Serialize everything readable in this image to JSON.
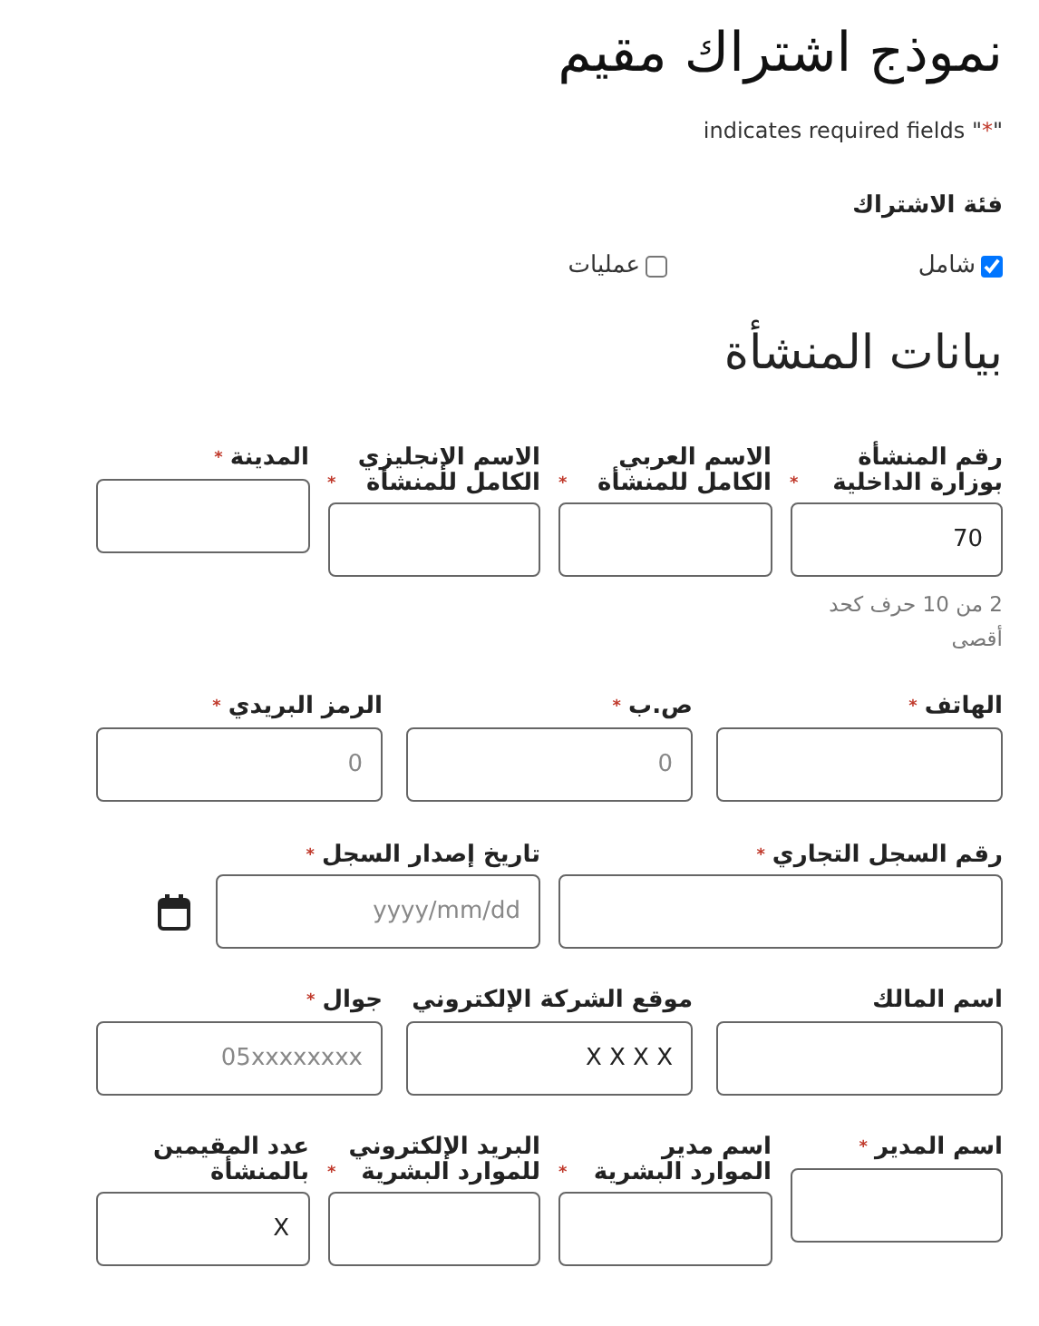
{
  "title": "نموذج اشتراك مقيم",
  "required_symbol": "*",
  "notice": {
    "before": "\"",
    "after": "\" indicates required fields"
  },
  "subscription": {
    "label": "فئة الاشتراك",
    "options": [
      {
        "label": "شامل",
        "checked": true
      },
      {
        "label": "عمليات",
        "checked": false
      }
    ]
  },
  "section_title": "بيانات المنشأة",
  "rows": [
    [
      {
        "kind": "text",
        "label": "رقم المنشأة بوزارة الداخلية",
        "required": true,
        "value": "70",
        "hint": "2 من 10 حرف كحد أقصى"
      },
      {
        "kind": "text",
        "label": "الاسم العربي الكامل للمنشأة",
        "required": true
      },
      {
        "kind": "text",
        "label": "الاسم الإنجليزي الكامل للمنشأة",
        "required": true
      },
      {
        "kind": "text",
        "label": "المدينة",
        "required": true
      }
    ],
    [
      {
        "kind": "text",
        "label": "الهاتف",
        "required": true
      },
      {
        "kind": "text",
        "label": "ص.ب",
        "required": true,
        "placeholder": "0"
      },
      {
        "kind": "text",
        "label": "الرمز البريدي",
        "required": true,
        "placeholder": "0"
      }
    ],
    [
      {
        "kind": "text",
        "label": "رقم السجل التجاري",
        "required": true
      },
      {
        "kind": "date",
        "label": "تاريخ إصدار السجل",
        "required": true,
        "placeholder": "yyyy/mm/dd"
      }
    ],
    [
      {
        "kind": "text",
        "label": "اسم المالك",
        "required": false
      },
      {
        "kind": "text",
        "label": "موقع الشركة الإلكتروني",
        "required": false,
        "value": "X X X X"
      },
      {
        "kind": "text",
        "label": "جوال",
        "required": true,
        "placeholder": "05xxxxxxxx"
      }
    ],
    [
      {
        "kind": "text",
        "label": "اسم المدير",
        "required": true
      },
      {
        "kind": "text",
        "label": "اسم مدير الموارد البشرية",
        "required": true
      },
      {
        "kind": "text",
        "label": "البريد الإلكتروني للموارد البشرية",
        "required": true
      },
      {
        "kind": "text",
        "label": "عدد المقيمين بالمنشأة",
        "required": false,
        "value": "X"
      }
    ]
  ]
}
